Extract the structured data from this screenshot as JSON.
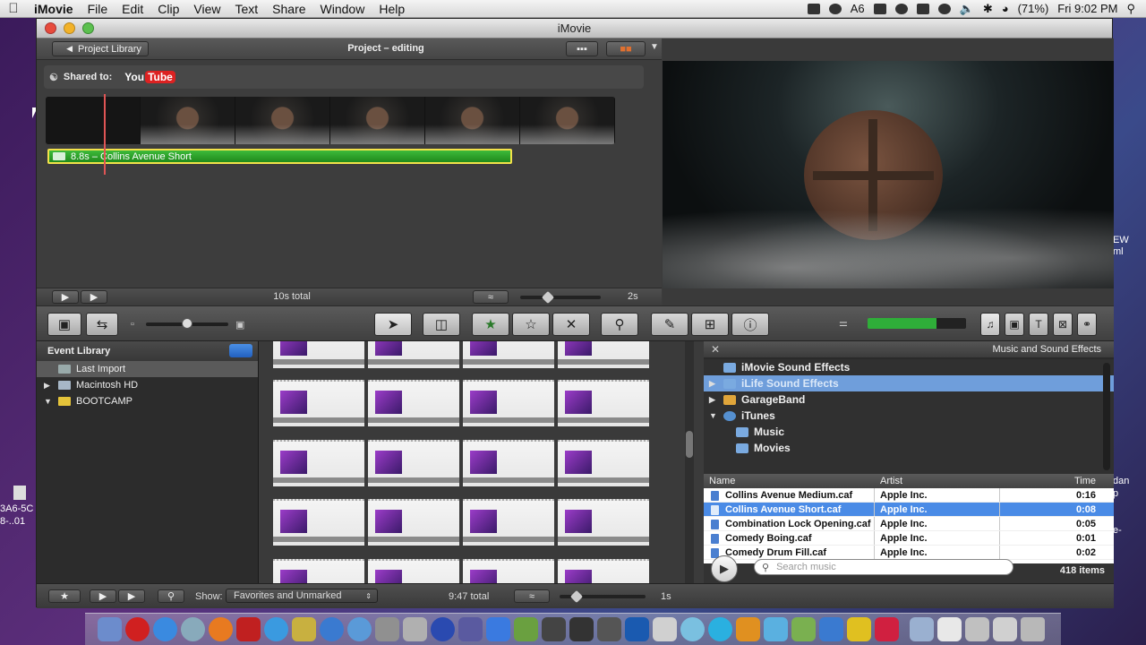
{
  "menubar": {
    "apple": "",
    "app_name": "iMovie",
    "items": [
      "File",
      "Edit",
      "Clip",
      "View",
      "Text",
      "Share",
      "Window",
      "Help"
    ],
    "status": {
      "battery_label": "6",
      "battery_percent": "(71%)",
      "clock": "Fri 9:02 PM"
    }
  },
  "window": {
    "title": "iMovie"
  },
  "project": {
    "library_button": "Project Library",
    "title": "Project – editing",
    "shared_to_label": "Shared to:",
    "youtube_you": "You",
    "youtube_tube": "Tube",
    "audio_clip_label": "8.8s – Collins Avenue Short",
    "total": "10s total",
    "zoom": "2s"
  },
  "event_library": {
    "header": "Event Library",
    "items": [
      {
        "label": "Last Import"
      },
      {
        "label": "Macintosh HD"
      },
      {
        "label": "BOOTCAMP"
      }
    ]
  },
  "music": {
    "title": "Music and Sound Effects",
    "sources": [
      {
        "label": "iMovie Sound Effects"
      },
      {
        "label": "iLife Sound Effects"
      },
      {
        "label": "GarageBand"
      },
      {
        "label": "iTunes"
      },
      {
        "label": "Music"
      },
      {
        "label": "Movies"
      }
    ],
    "columns": {
      "name": "Name",
      "artist": "Artist",
      "time": "Time"
    },
    "songs": [
      {
        "name": "Collins Avenue Medium.caf",
        "artist": "Apple Inc.",
        "time": "0:16"
      },
      {
        "name": "Collins Avenue Short.caf",
        "artist": "Apple Inc.",
        "time": "0:08"
      },
      {
        "name": "Combination Lock Opening.caf",
        "artist": "Apple Inc.",
        "time": "0:05"
      },
      {
        "name": "Comedy Boing.caf",
        "artist": "Apple Inc.",
        "time": "0:01"
      },
      {
        "name": "Comedy Drum Fill.caf",
        "artist": "Apple Inc.",
        "time": "0:02"
      }
    ],
    "search_placeholder": "Search music",
    "count": "418 items"
  },
  "footer": {
    "show_label": "Show:",
    "show_value": "Favorites and Unmarked",
    "event_total": "9:47 total",
    "event_zoom": "1s"
  },
  "desktop": {
    "left_text_1": "3A6-5C",
    "left_text_2": "8-..01",
    "right_text_1": "EW",
    "right_text_2": "ml",
    "right_text_3": "dan",
    "right_text_4": "p",
    "right_text_5": "e-"
  }
}
